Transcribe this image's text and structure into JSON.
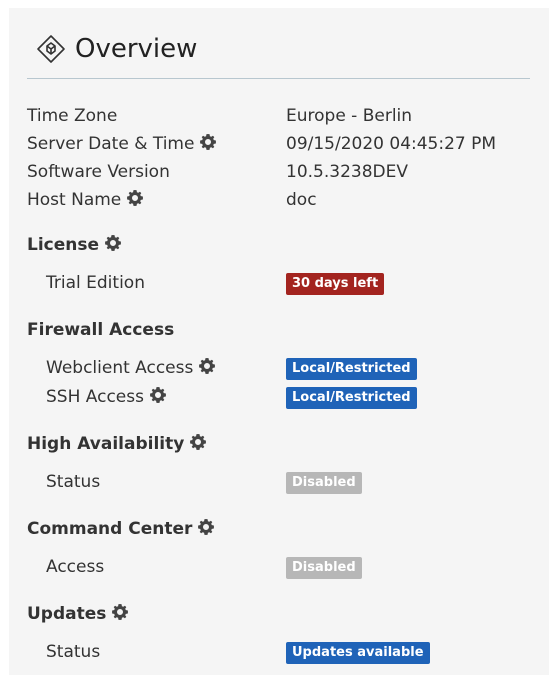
{
  "header": {
    "title": "Overview",
    "icon": "diamond-cube-icon"
  },
  "info": {
    "timezone": {
      "label": "Time Zone",
      "value": "Europe - Berlin"
    },
    "datetime": {
      "label": "Server Date & Time",
      "value": "09/15/2020 04:45:27 PM"
    },
    "version": {
      "label": "Software Version",
      "value": "10.5.3238DEV"
    },
    "hostname": {
      "label": "Host Name",
      "value": "doc"
    }
  },
  "license": {
    "label": "License",
    "edition": "Trial Edition",
    "badge": "30 days left"
  },
  "firewall": {
    "label": "Firewall Access",
    "webclient_label": "Webclient Access",
    "webclient_badge": "Local/Restricted",
    "ssh_label": "SSH Access",
    "ssh_badge": "Local/Restricted"
  },
  "ha": {
    "label": "High Availability",
    "status_label": "Status",
    "status_badge": "Disabled"
  },
  "command_center": {
    "label": "Command Center",
    "access_label": "Access",
    "access_badge": "Disabled"
  },
  "updates": {
    "label": "Updates",
    "status_label": "Status",
    "status_badge": "Updates available"
  },
  "colors": {
    "badge_red": "#a3241f",
    "badge_blue": "#1f63b8",
    "badge_gray": "#b7b7b7",
    "gear": "#444444"
  }
}
